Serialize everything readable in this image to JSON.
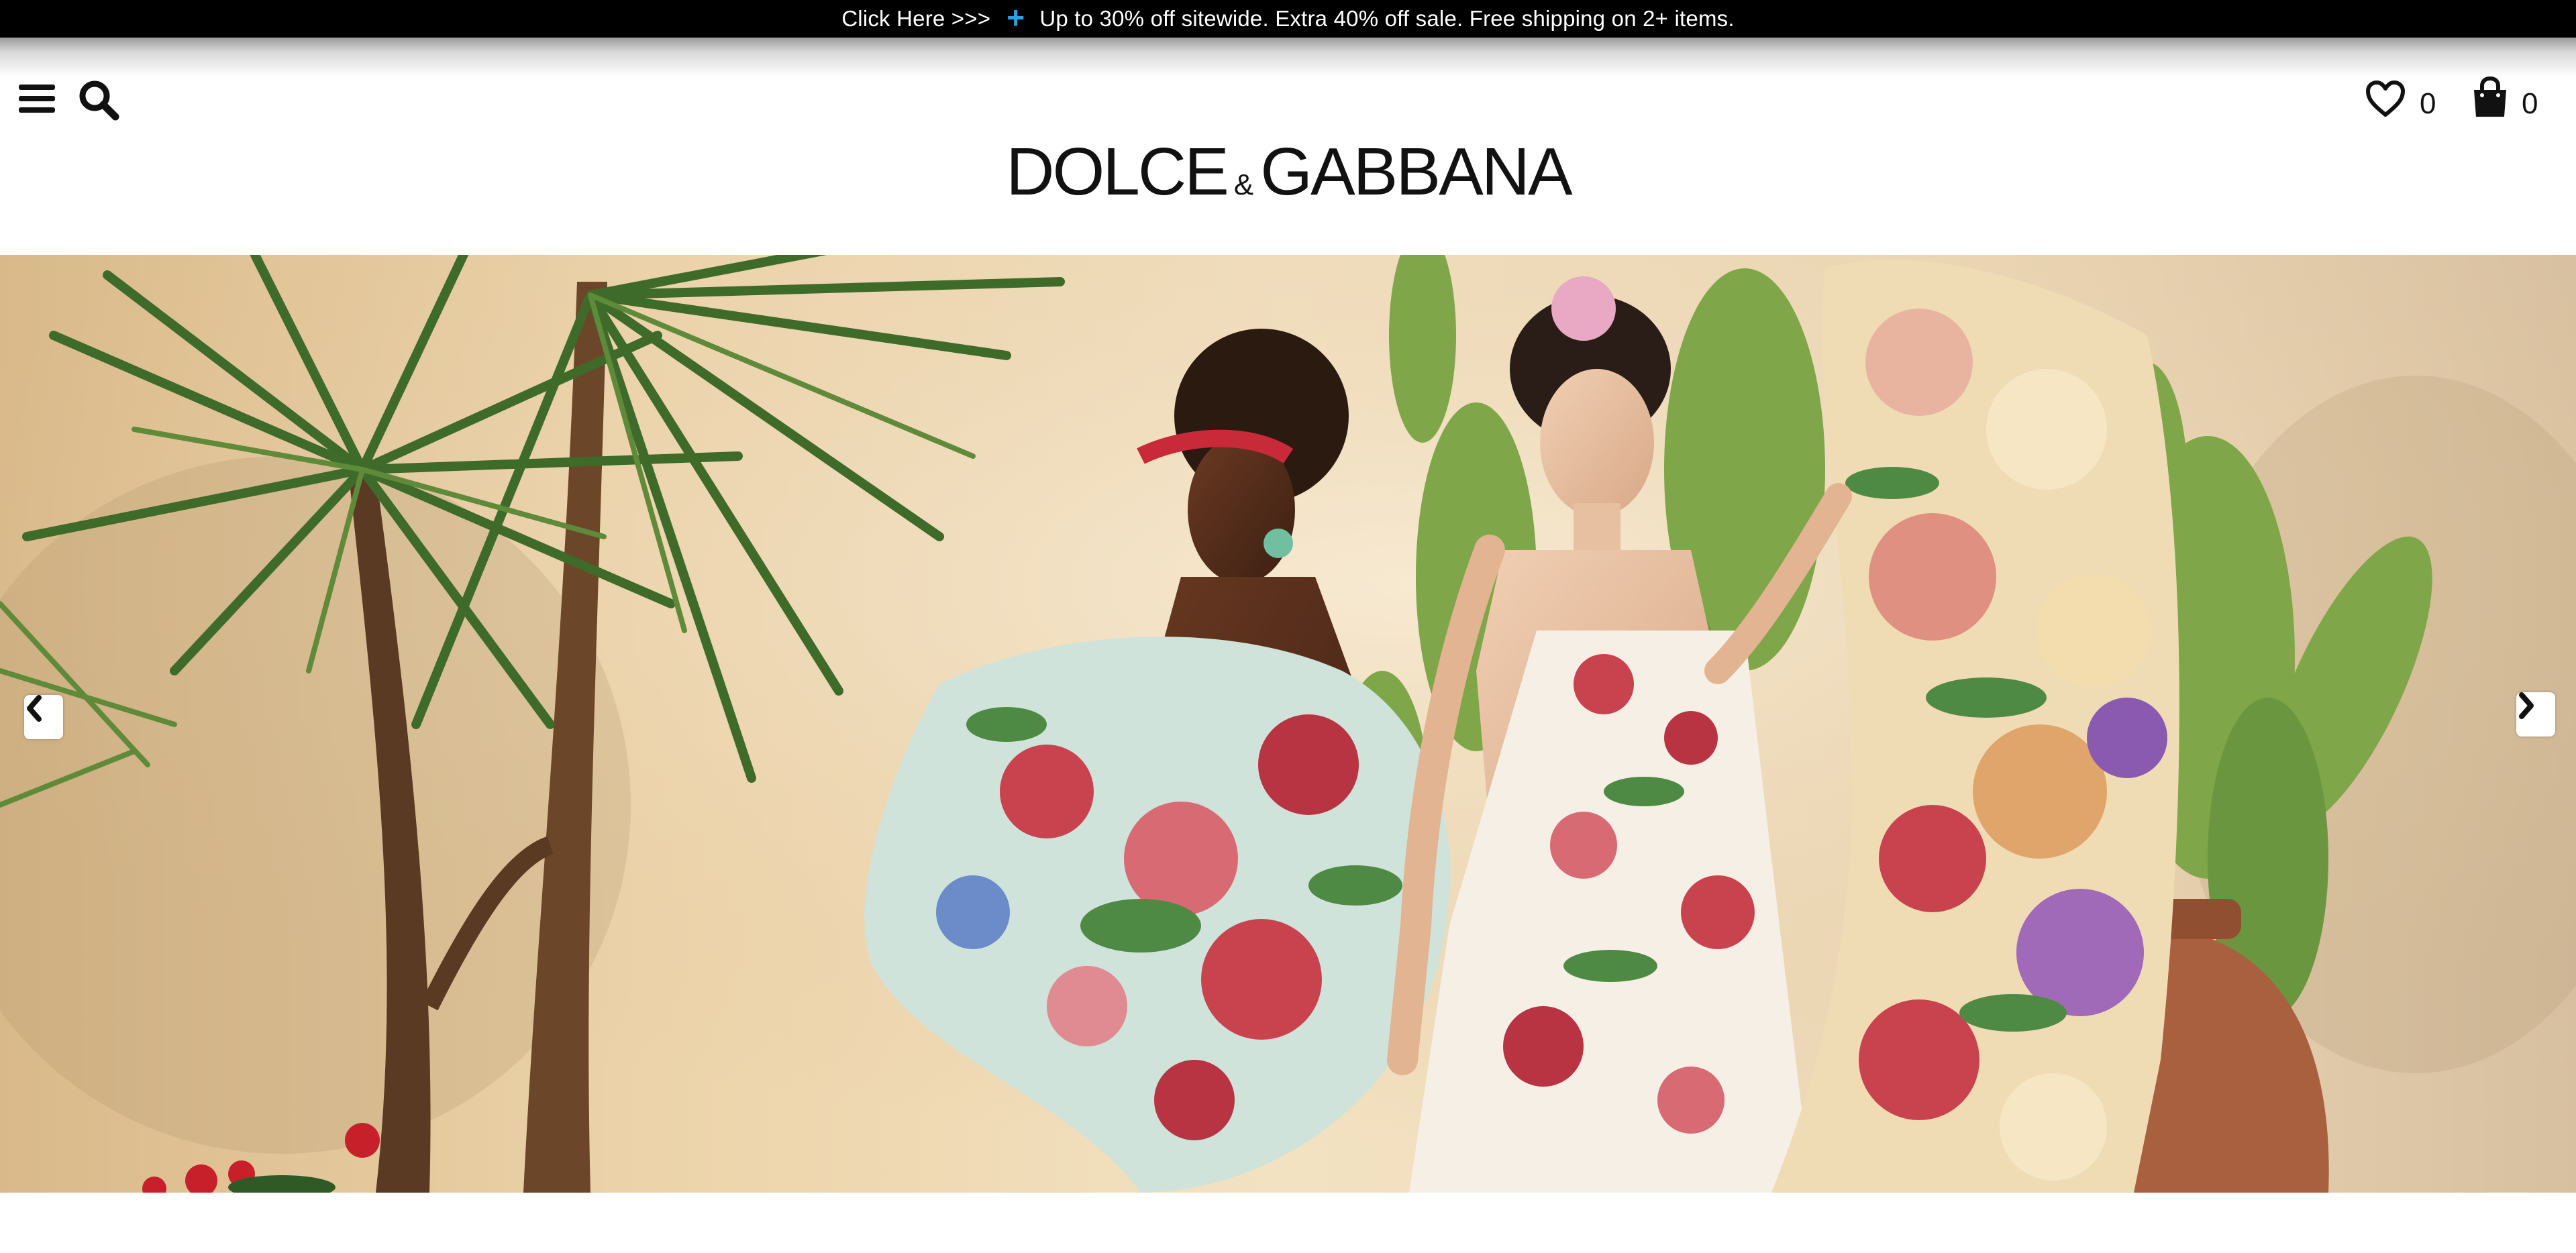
{
  "promo": {
    "link_text": "Click Here >>>",
    "plus": "+",
    "message": "Up to 30% off sitewide. Extra 40% off sale. Free shipping on 2+ items."
  },
  "header": {
    "logo_main": "DOLCE",
    "logo_amp": "&",
    "logo_second": "GABBANA",
    "wishlist_count": "0",
    "bag_count": "0",
    "icons": [
      "menu-icon",
      "search-icon",
      "heart-icon",
      "shopping-bag-icon"
    ]
  },
  "hero": {
    "description_icons": [
      "chevron-left-icon",
      "chevron-right-icon"
    ],
    "colors": {
      "wall": "#f3e2c2",
      "palm": "#3f6b2a",
      "cactus": "#7fa648",
      "floral_rose": "#c9434f"
    }
  },
  "colors": {
    "promo_bg": "#000000",
    "promo_text": "#ffffff",
    "promo_plus": "#2aa0e6",
    "page_bg": "#ffffff"
  }
}
